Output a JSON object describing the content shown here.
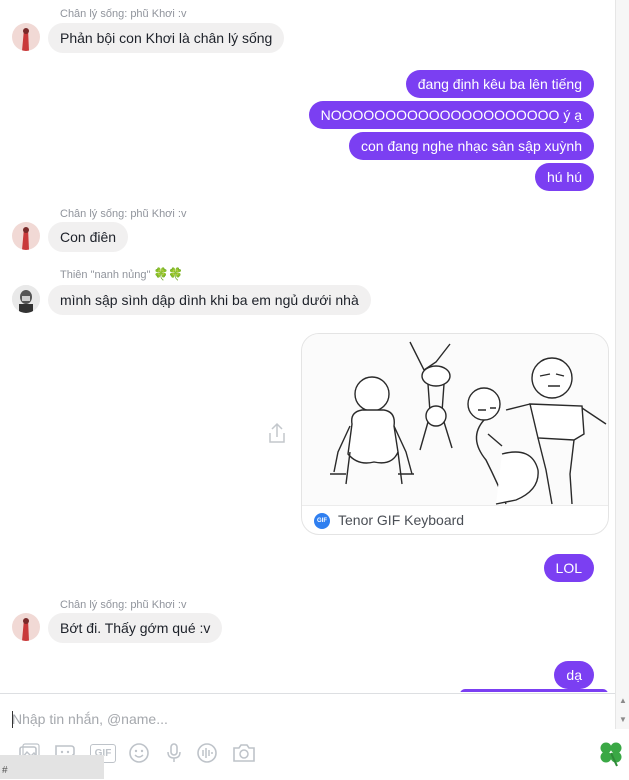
{
  "messages": {
    "m1": {
      "sender": "Chân lý sống: phũ Khơi :v",
      "text": "Phản bội con Khơi là chân lý sống"
    },
    "out1": [
      "đang định kêu ba lên tiếng",
      "NOOOOOOOOOOOOOOOOOOOOO ý ạ",
      "con đang nghe nhạc sàn sập xuỳnh",
      "hú hú"
    ],
    "m2": {
      "sender": "Chân lý sống: phũ Khơi :v",
      "text": "Con điên"
    },
    "m3": {
      "sender": "Thiên \"nanh nủng\"",
      "sender_emoji": "🍀🍀",
      "text": "mình sập sình dập dình khi ba em ngủ dưới nhà"
    },
    "gif": {
      "source": "Tenor GIF Keyboard",
      "badge": "GIF"
    },
    "out2": "LOL",
    "m4": {
      "sender": "Chân lý sống: phũ Khơi :v",
      "text": "Bớt đi. Thấy gớm qué :v"
    },
    "out3": "dạ"
  },
  "composer": {
    "placeholder": "Nhập tin nhắn, @name...",
    "tools": [
      "image-icon",
      "sticker-icon",
      "gif-icon",
      "emoji-icon",
      "microphone-icon",
      "audio-clip-icon",
      "camera-icon"
    ],
    "gif_tool_label": "GIF",
    "like_icon": "four-leaf-clover-icon"
  },
  "colors": {
    "outgoing": "#7b3ff2",
    "incoming": "#f1f0f0",
    "sender_name": "#90949c"
  },
  "taskbar_text": "#"
}
